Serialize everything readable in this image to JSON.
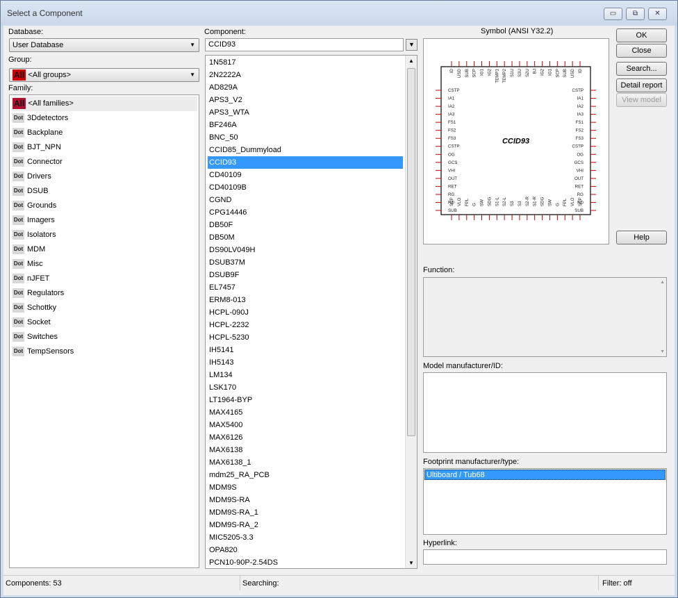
{
  "window": {
    "title": "Select a Component",
    "minimize": "▭",
    "restore": "⧉",
    "close": "✕"
  },
  "database": {
    "label": "Database:",
    "value": "User Database"
  },
  "group": {
    "label": "Group:",
    "badge": "All",
    "value": "<All groups>"
  },
  "family": {
    "label": "Family:",
    "all_badge": "All",
    "icon_text": "Dot",
    "items": [
      "<All families>",
      "3Ddetectors",
      "Backplane",
      "BJT_NPN",
      "Connector",
      "Drivers",
      "DSUB",
      "Grounds",
      "Imagers",
      "Isolators",
      "MDM",
      "Misc",
      "nJFET",
      "Regulators",
      "Schottky",
      "Socket",
      "Switches",
      "TempSensors"
    ]
  },
  "component": {
    "label": "Component:",
    "search_value": "CCID93",
    "filter_icon": "filter-icon",
    "selected": "CCID93",
    "items": [
      "1N5817",
      "2N2222A",
      "AD829A",
      "APS3_V2",
      "APS3_WTA",
      "BF246A",
      "BNC_50",
      "CCID85_Dummyload",
      "CCID93",
      "CD40109",
      "CD40109B",
      "CGND",
      "CPG14446",
      "DB50F",
      "DB50M",
      "DS90LV049H",
      "DSUB37M",
      "DSUB9F",
      "EL7457",
      "ERM8-013",
      "HCPL-090J",
      "HCPL-2232",
      "HCPL-5230",
      "IH5141",
      "IH5143",
      "LM134",
      "LSK170",
      "LT1964-BYP",
      "MAX4165",
      "MAX5400",
      "MAX6126",
      "MAX6138",
      "MAX6138_1",
      "mdm25_RA_PCB",
      "MDM9S",
      "MDM9S-RA",
      "MDM9S-RA_1",
      "MDM9S-RA_2",
      "MIC5205-3.3",
      "OPA820",
      "PCN10-90P-2.54DS"
    ]
  },
  "symbol": {
    "label": "Symbol (ANSI Y32.2)",
    "part_name": "CCID93",
    "top_pins": [
      "ID",
      "USD",
      "SUB",
      "SCP",
      "IG1",
      "IG2",
      "TEMP1",
      "TEMP2",
      "S1U",
      "S3U",
      "S2U",
      "BJ",
      "IG2",
      "IG1",
      "SCP",
      "SUB",
      "USD",
      "ID"
    ],
    "bottom_pins": [
      "SCP",
      "VLO",
      "FPL",
      "G",
      "SW",
      "SDG",
      "S1-L",
      "S2-L",
      "S3",
      "S3",
      "S2-R",
      "S1-R",
      "SDG",
      "SW",
      "G",
      "FPL",
      "VLO",
      "SCP"
    ],
    "left_pins": [
      "CSTP",
      "IA1",
      "IA2",
      "IA3",
      "FS1",
      "FS2",
      "FS3",
      "CSTP",
      "OG",
      "GCS",
      "VHI",
      "OUT",
      "RET",
      "RG",
      "RD",
      "SUB"
    ],
    "right_pins": [
      "CSTP",
      "IA1",
      "IA2",
      "IA3",
      "FS1",
      "FS2",
      "FS3",
      "CSTP",
      "OG",
      "GCS",
      "VHI",
      "OUT",
      "RET",
      "RG",
      "RD",
      "SUB"
    ],
    "pin_color": "#c00000"
  },
  "buttons": {
    "ok": "OK",
    "close": "Close",
    "search": "Search...",
    "detail_report": "Detail report",
    "view_model": "View model",
    "help": "Help"
  },
  "function": {
    "label": "Function:"
  },
  "model": {
    "label": "Model manufacturer/ID:"
  },
  "footprint": {
    "label": "Footprint manufacturer/type:",
    "items": [
      "Ultiboard / Tub68"
    ]
  },
  "hyperlink": {
    "label": "Hyperlink:"
  },
  "status": {
    "components": "Components: 53",
    "searching": "Searching:",
    "filter": "Filter: off"
  }
}
